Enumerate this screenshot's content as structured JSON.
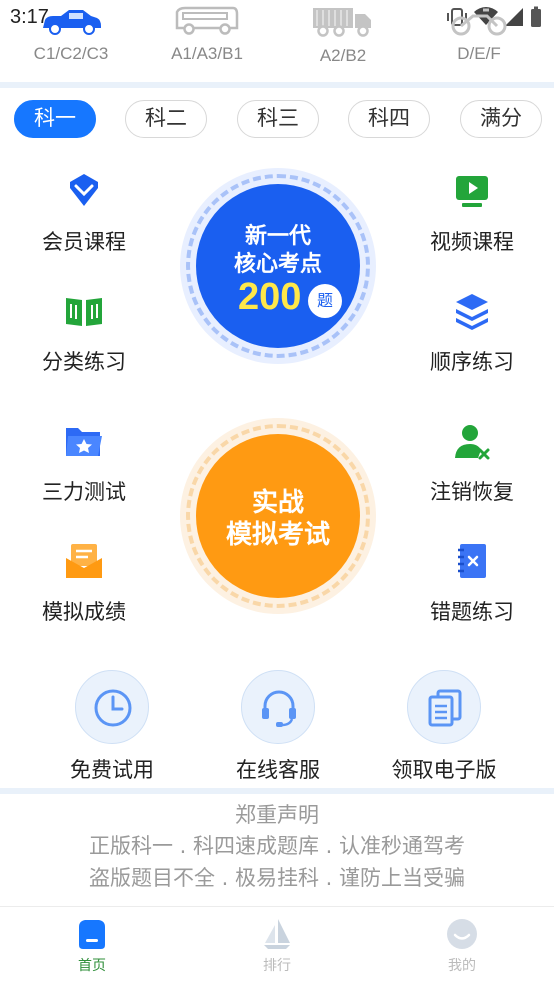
{
  "status_bar": {
    "time": "3:17"
  },
  "vehicles": [
    {
      "label": "C1/C2/C3",
      "icon": "car-icon"
    },
    {
      "label": "A1/A3/B1",
      "icon": "bus-icon"
    },
    {
      "label": "A2/B2",
      "icon": "truck-icon"
    },
    {
      "label": "D/E/F",
      "icon": "motorcycle-icon"
    }
  ],
  "subject_tabs": [
    {
      "label": "科一",
      "active": true
    },
    {
      "label": "科二",
      "active": false
    },
    {
      "label": "科三",
      "active": false
    },
    {
      "label": "科四",
      "active": false
    },
    {
      "label": "满分",
      "active": false
    }
  ],
  "features": {
    "member_course": "会员课程",
    "video_course": "视频课程",
    "category_practice": "分类练习",
    "sequential_practice": "顺序练习",
    "ability_test": "三力测试",
    "cancel_restore": "注销恢复",
    "mock_score": "模拟成绩",
    "wrong_practice": "错题练习"
  },
  "core_points": {
    "line1": "新一代",
    "line2": "核心考点",
    "number": "200",
    "unit": "题"
  },
  "mock_exam": {
    "line1": "实战",
    "line2": "模拟考试"
  },
  "actions": {
    "free_trial": "免费试用",
    "online_service": "在线客服",
    "get_ebook": "领取电子版"
  },
  "disclaimer": {
    "title": "郑重声明",
    "line1": "正版科一 . 科四速成题库 . 认准秒通驾考",
    "line2": "盗版题目不全 . 极易挂科 . 谨防上当受骗"
  },
  "bottom_nav": {
    "home": "首页",
    "ranking": "排行",
    "mine": "我的"
  },
  "colors": {
    "primary_blue": "#1677ff",
    "core_blue": "#1a5ff0",
    "exam_orange": "#ff9a12",
    "nav_active_green": "#2f8f3a"
  }
}
